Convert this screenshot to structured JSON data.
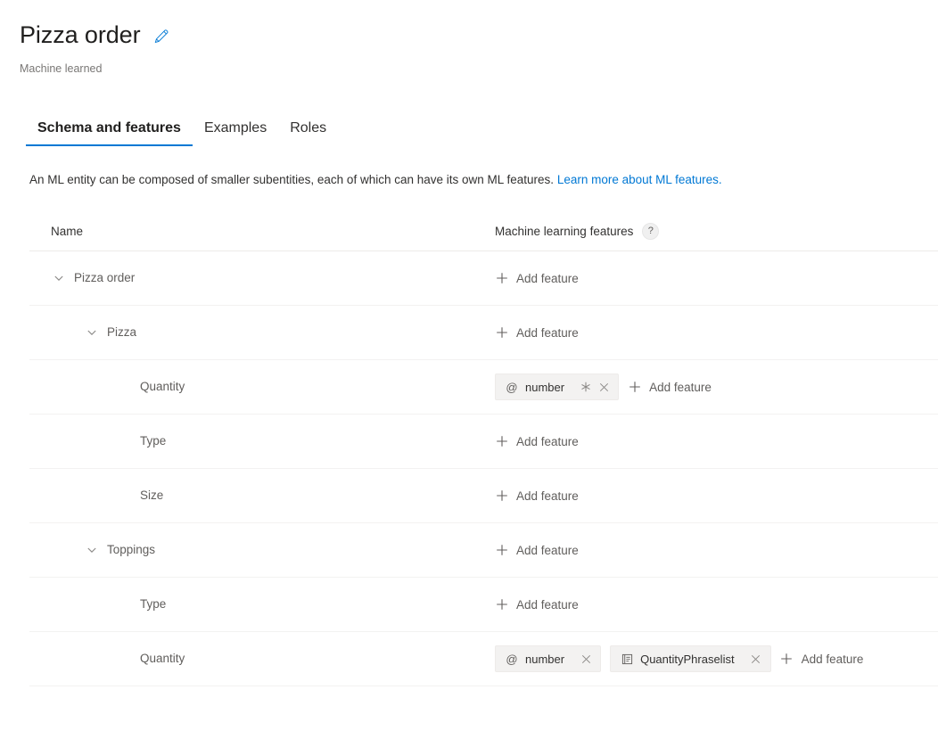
{
  "header": {
    "title": "Pizza order",
    "subtitle": "Machine learned",
    "edit_icon": "pencil-icon",
    "accent_color": "#0078d4"
  },
  "tabs": [
    {
      "label": "Schema and features",
      "active": true
    },
    {
      "label": "Examples",
      "active": false
    },
    {
      "label": "Roles",
      "active": false
    }
  ],
  "description": {
    "text": "An ML entity can be composed of smaller subentities, each of which can have its own ML features. ",
    "link_text": "Learn more about ML features."
  },
  "table": {
    "columns": {
      "name": "Name",
      "features": "Machine learning features",
      "help_icon": "?"
    },
    "add_feature_label": "Add feature",
    "rows": [
      {
        "name": "Pizza order",
        "level": 1,
        "expandable": true,
        "chips": []
      },
      {
        "name": "Pizza",
        "level": 2,
        "expandable": true,
        "chips": []
      },
      {
        "name": "Quantity",
        "level": 3,
        "expandable": false,
        "chips": [
          {
            "icon": "at-sign-icon",
            "icon_glyph": "@",
            "label": "number",
            "required": true,
            "closable": true
          }
        ]
      },
      {
        "name": "Type",
        "level": 3,
        "expandable": false,
        "chips": []
      },
      {
        "name": "Size",
        "level": 3,
        "expandable": false,
        "chips": []
      },
      {
        "name": "Toppings",
        "level": 2,
        "expandable": true,
        "chips": []
      },
      {
        "name": "Type",
        "level": 3,
        "expandable": false,
        "chips": []
      },
      {
        "name": "Quantity",
        "level": 3,
        "expandable": false,
        "chips": [
          {
            "icon": "at-sign-icon",
            "icon_glyph": "@",
            "label": "number",
            "required": false,
            "closable": true
          },
          {
            "icon": "phraselist-icon",
            "icon_glyph": "",
            "label": "QuantityPhraselist",
            "required": false,
            "closable": true
          }
        ]
      }
    ]
  }
}
